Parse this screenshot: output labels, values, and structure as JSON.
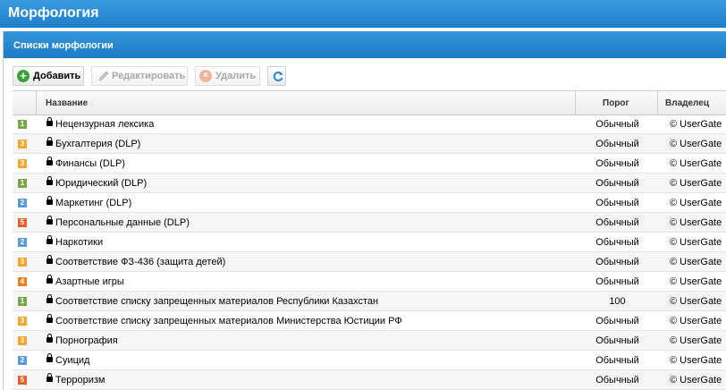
{
  "window": {
    "title": "Морфология"
  },
  "panel": {
    "title": "Списки морфологии"
  },
  "toolbar": {
    "add_label": "Добавить",
    "edit_label": "Редактировать",
    "delete_label": "Удалить"
  },
  "table": {
    "columns": {
      "name": "Название",
      "threshold": "Порог",
      "owner": "Владелец"
    },
    "rows": [
      {
        "level": "1",
        "color": "#7aa54a",
        "name": "Нецензурная лексика",
        "threshold": "Обычный",
        "owner": "© UserGate"
      },
      {
        "level": "3",
        "color": "#f0a830",
        "name": "Бухгалтерия (DLP)",
        "threshold": "Обычный",
        "owner": "© UserGate"
      },
      {
        "level": "3",
        "color": "#f0a830",
        "name": "Финансы (DLP)",
        "threshold": "Обычный",
        "owner": "© UserGate"
      },
      {
        "level": "1",
        "color": "#7aa54a",
        "name": "Юридический (DLP)",
        "threshold": "Обычный",
        "owner": "© UserGate"
      },
      {
        "level": "2",
        "color": "#5b9bd5",
        "name": "Маркетинг (DLP)",
        "threshold": "Обычный",
        "owner": "© UserGate"
      },
      {
        "level": "5",
        "color": "#e0622a",
        "name": "Персональные данные (DLP)",
        "threshold": "Обычный",
        "owner": "© UserGate"
      },
      {
        "level": "2",
        "color": "#5b9bd5",
        "name": "Наркотики",
        "threshold": "Обычный",
        "owner": "© UserGate"
      },
      {
        "level": "3",
        "color": "#f0a830",
        "name": "Соответствие ФЗ-436 (защита детей)",
        "threshold": "Обычный",
        "owner": "© UserGate"
      },
      {
        "level": "4",
        "color": "#e3841f",
        "name": "Азартные игры",
        "threshold": "Обычный",
        "owner": "© UserGate"
      },
      {
        "level": "1",
        "color": "#7aa54a",
        "name": "Соответствие списку запрещенных материалов Республики Казахстан",
        "threshold": "100",
        "owner": "© UserGate"
      },
      {
        "level": "3",
        "color": "#f0a830",
        "name": "Соответствие списку запрещенных материалов Министерства Юстиции РФ",
        "threshold": "Обычный",
        "owner": "© UserGate"
      },
      {
        "level": "3",
        "color": "#f0a830",
        "name": "Порнография",
        "threshold": "Обычный",
        "owner": "© UserGate"
      },
      {
        "level": "2",
        "color": "#5b9bd5",
        "name": "Суицид",
        "threshold": "Обычный",
        "owner": "© UserGate"
      },
      {
        "level": "5",
        "color": "#e0622a",
        "name": "Терроризм",
        "threshold": "Обычный",
        "owner": "© UserGate"
      }
    ]
  }
}
